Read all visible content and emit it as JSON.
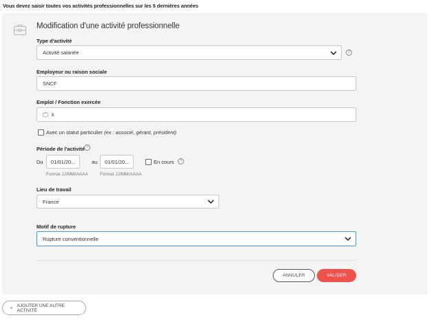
{
  "notice": "Vous devez saisir toutes vos activités professionnelles sur les 5 dernières années",
  "form": {
    "title": "Modification d'une activité professionnelle",
    "type_label": "Type d'activité",
    "type_value": "Activité salariée",
    "employer_label": "Employeur ou raison sociale",
    "employer_value": "SNCF",
    "job_label": "Emploi / Fonction exercée",
    "job_value": "k",
    "statut_text": "Avec un statut particulier",
    "statut_hint": "(ex : associé, gérant, président)",
    "period_label": "Période de l'activité",
    "du": "Du",
    "date_start": "01/01/20...",
    "au": "au",
    "date_end": "01/01/20...",
    "en_cours": "En cours",
    "format_hint_1": "Format JJ/MM/AAAA",
    "format_hint_2": "Format JJ/MM/AAAA",
    "place_label": "Lieu de travail",
    "place_value": "France",
    "motif_label": "Motif de rupture",
    "motif_value": "Rupture conventionnelle",
    "help_glyph": "?"
  },
  "buttons": {
    "cancel": "ANNULER",
    "validate": "VALIDER",
    "add": "AJOUTER UNE AUTRE ACTIVITÉ",
    "add_glyph": "+"
  },
  "colors": {
    "accent": "#f0524b",
    "focus": "#3a9fd8",
    "card_bg": "#f4f4f4"
  },
  "icons": [
    "briefcase-icon",
    "chevron-down-icon",
    "help-icon",
    "plus-icon"
  ]
}
